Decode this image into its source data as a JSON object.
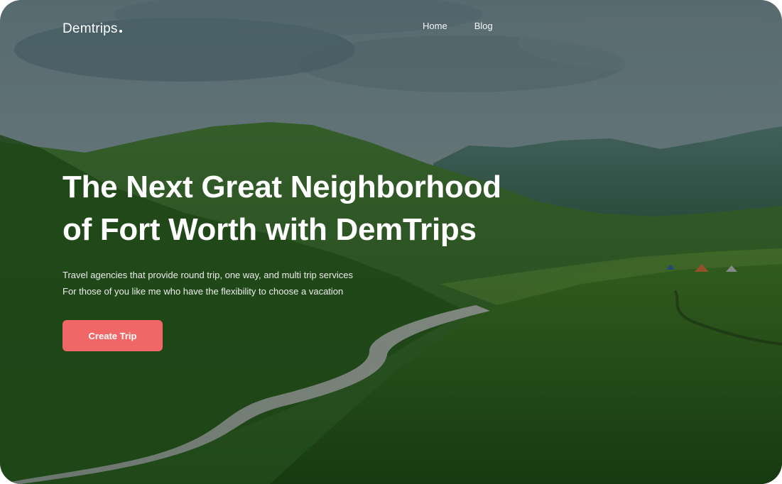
{
  "brand": {
    "name": "Demtrips"
  },
  "nav": {
    "items": [
      {
        "label": "Home"
      },
      {
        "label": "Blog"
      }
    ]
  },
  "hero": {
    "title_line1": "The Next Great Neighborhood",
    "title_line2": "of Fort Worth with DemTrips",
    "subtitle_line1": "Travel agencies that provide round trip, one way, and multi trip services",
    "subtitle_line2": "For those of you like me who have the flexibility to choose a vacation",
    "cta_label": "Create Trip"
  },
  "colors": {
    "accent": "#f16767",
    "text": "#ffffff"
  }
}
